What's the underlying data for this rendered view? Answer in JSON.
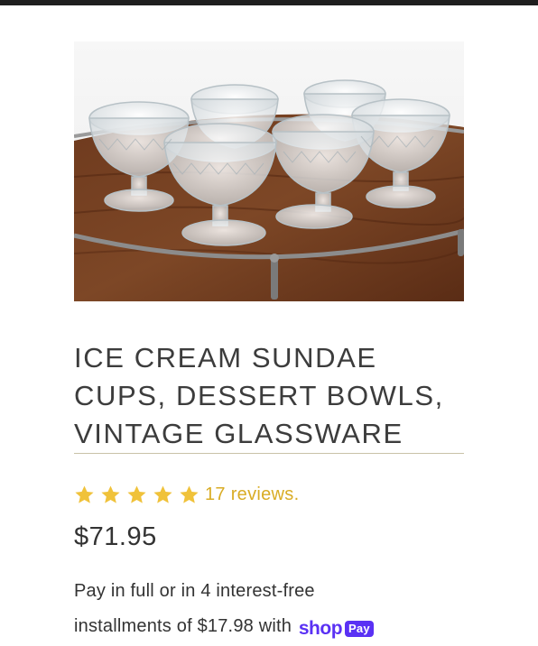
{
  "product": {
    "title_lines": [
      "ICE CREAM SUNDAE",
      "CUPS, DESSERT BOWLS,",
      "VINTAGE GLASSWARE"
    ],
    "image_icon": "glass-sundae-cups-photo",
    "rating": {
      "stars": 5,
      "max_stars": 5,
      "reviews_label": "17 reviews."
    },
    "price": "$71.95",
    "installments": {
      "line1": "Pay in full or in 4 interest-free",
      "line2": "installments of $17.98 with",
      "shop_word": "shop",
      "pay_badge": "Pay"
    }
  },
  "colors": {
    "star": "#f0c23a",
    "reviews": "#d9ac25",
    "shop_pay": "#5a31f4",
    "topbar": "#1e1e1e",
    "divider": "#c9c2a8"
  }
}
